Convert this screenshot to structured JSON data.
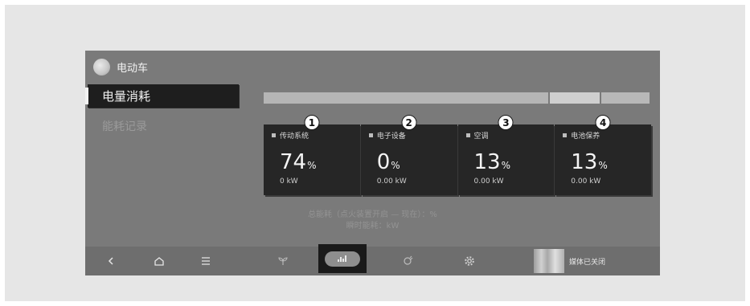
{
  "header": {
    "title": "电动车",
    "avatar_icon": "moon-avatar-icon"
  },
  "sidebar": {
    "items": [
      {
        "label": "电量消耗",
        "active": true
      },
      {
        "label": "能耗记录",
        "active": false
      }
    ]
  },
  "distribution_bar": {
    "segments": [
      0.74,
      0.13,
      0.13
    ]
  },
  "cards": [
    {
      "badge": "1",
      "name": "传动系统",
      "percent": "74",
      "unit": "%",
      "power": "0 kW"
    },
    {
      "badge": "2",
      "name": "电子设备",
      "percent": "0",
      "unit": "%",
      "power": "0.00 kW"
    },
    {
      "badge": "3",
      "name": "空调",
      "percent": "13",
      "unit": "%",
      "power": "0.00 kW"
    },
    {
      "badge": "4",
      "name": "电池保养",
      "percent": "13",
      "unit": "%",
      "power": "0.00 kW"
    }
  ],
  "summary": {
    "total": "总能耗（点火装置开启 — 现在）：%",
    "instant": "瞬时能耗：kW"
  },
  "navbar": {
    "icons": [
      "back-icon",
      "home-icon",
      "menu-icon",
      "eco-leaf-icon",
      "energy-chart-icon",
      "charging-icon",
      "settings-icon"
    ],
    "media_label": "媒体已关闭"
  }
}
